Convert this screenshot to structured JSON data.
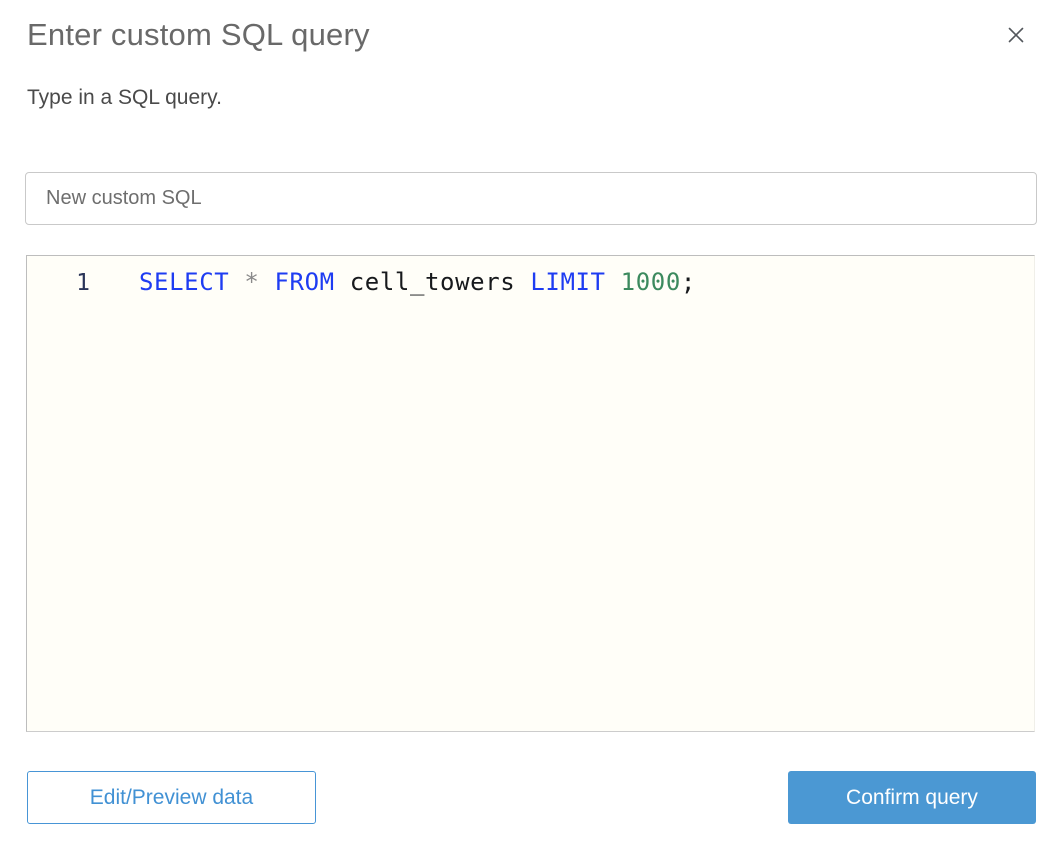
{
  "dialog": {
    "title": "Enter custom SQL query",
    "subtitle": "Type in a SQL query.",
    "close_icon": "x"
  },
  "query_name_input": {
    "value": "New custom SQL"
  },
  "sql_editor": {
    "line_number": "1",
    "query_text": "SELECT * FROM cell_towers LIMIT 1000;",
    "tokens": [
      {
        "text": "SELECT",
        "type": "keyword"
      },
      {
        "text": " ",
        "type": "plain"
      },
      {
        "text": "*",
        "type": "operator"
      },
      {
        "text": " ",
        "type": "plain"
      },
      {
        "text": "FROM",
        "type": "keyword"
      },
      {
        "text": " ",
        "type": "plain"
      },
      {
        "text": "cell_towers",
        "type": "identifier"
      },
      {
        "text": " ",
        "type": "plain"
      },
      {
        "text": "LIMIT",
        "type": "keyword"
      },
      {
        "text": " ",
        "type": "plain"
      },
      {
        "text": "1000",
        "type": "number"
      },
      {
        "text": ";",
        "type": "plain"
      }
    ]
  },
  "footer": {
    "edit_preview_label": "Edit/Preview data",
    "confirm_label": "Confirm query"
  },
  "colors": {
    "keyword_blue": "#1e3cf2",
    "number_green": "#3c8a5e",
    "operator_gray": "#8a8a8a",
    "identifier_black": "#17191c",
    "accent_blue": "#4b98d3",
    "editor_background": "#fffef8"
  }
}
